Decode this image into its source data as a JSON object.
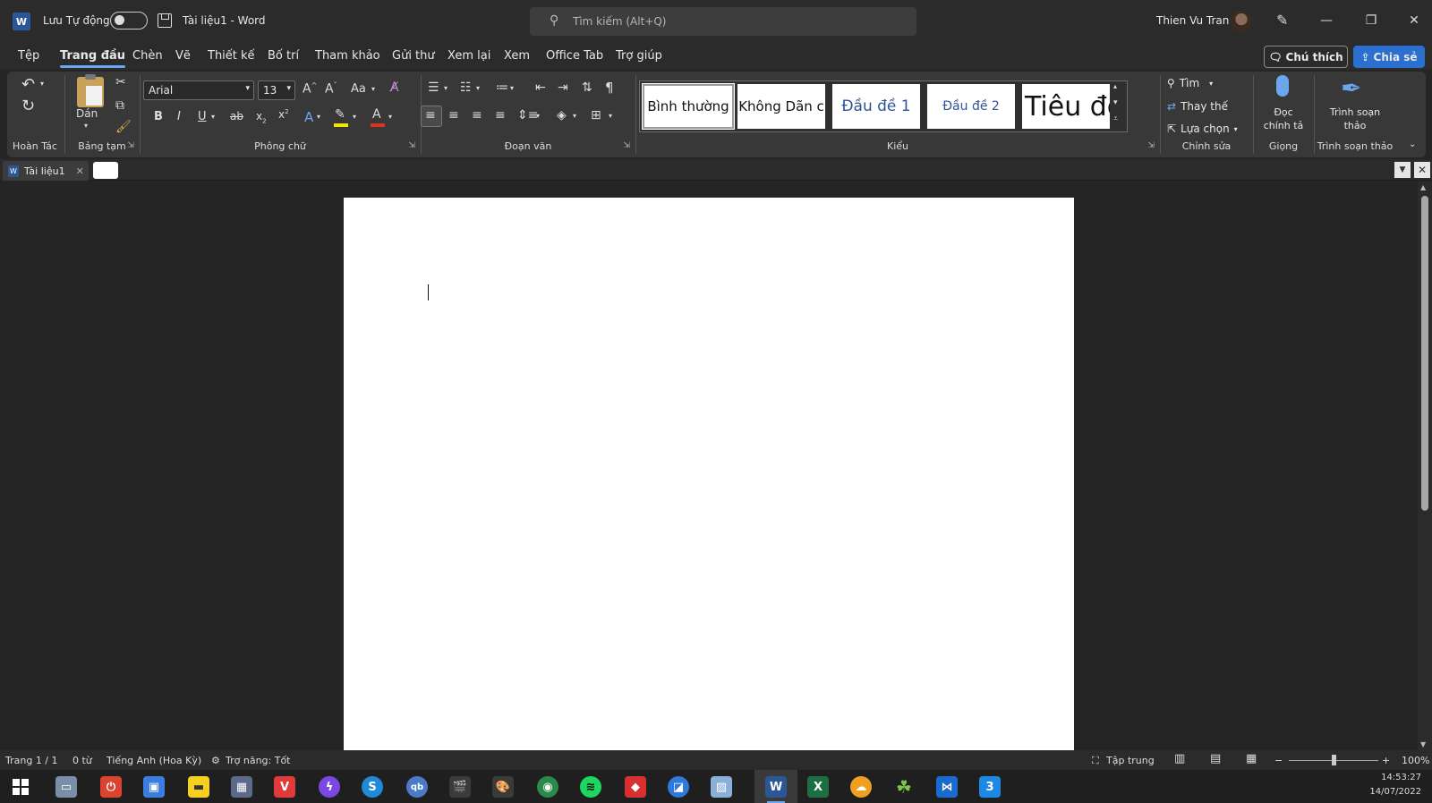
{
  "titlebar": {
    "app_icon": "word-icon",
    "autosave_label": "Lưu Tự động",
    "autosave_state": "off",
    "doc_title": "Tài liệu1  -  Word",
    "search_placeholder": "Tìm kiếm (Alt+Q)",
    "user_name": "Thien Vu Tran"
  },
  "menu": {
    "tabs": [
      "Tệp",
      "Trang đầu",
      "Chèn",
      "Vẽ",
      "Thiết kế",
      "Bố trí",
      "Tham khảo",
      "Gửi thư",
      "Xem lại",
      "Xem",
      "Office Tab",
      "Trợ giúp"
    ],
    "active_tab": "Trang đầu",
    "comment_label": "Chú thích",
    "share_label": "Chia sẻ"
  },
  "ribbon": {
    "groups": {
      "undo": "Hoàn Tác",
      "clipboard": "Bảng tạm",
      "font": "Phông chữ",
      "paragraph": "Đoạn văn",
      "styles": "Kiểu",
      "editing": "Chỉnh sửa",
      "voice": "Giọng",
      "editor": "Trình soạn thảo"
    },
    "paste_label": "Dán",
    "font_name": "Arial",
    "font_size": "13",
    "change_case": "Aa",
    "styles": [
      "Bình thường",
      "Không Dãn c",
      "Đầu đề 1",
      "Đầu đề 2",
      "Tiêu đề"
    ],
    "find_label": "Tìm",
    "replace_label": "Thay thế",
    "select_label": "Lựa chọn",
    "dictate_label": "Đọc chính tả",
    "editor_label": "Trình soạn thảo"
  },
  "doc_tabs": {
    "active": "Tài liệu1"
  },
  "status": {
    "page": "Trang 1 / 1",
    "words": "0 từ",
    "language": "Tiếng Anh (Hoa Kỳ)",
    "accessibility": "Trợ năng: Tốt",
    "focus": "Tập trung",
    "zoom": "100%",
    "zoom_fraction": 0.5
  },
  "taskbar": {
    "time": "14:53:27",
    "date": "14/07/2022"
  },
  "colors": {
    "accent": "#2b6fd0",
    "word_blue": "#2b5797",
    "excel_green": "#1d6f42"
  }
}
